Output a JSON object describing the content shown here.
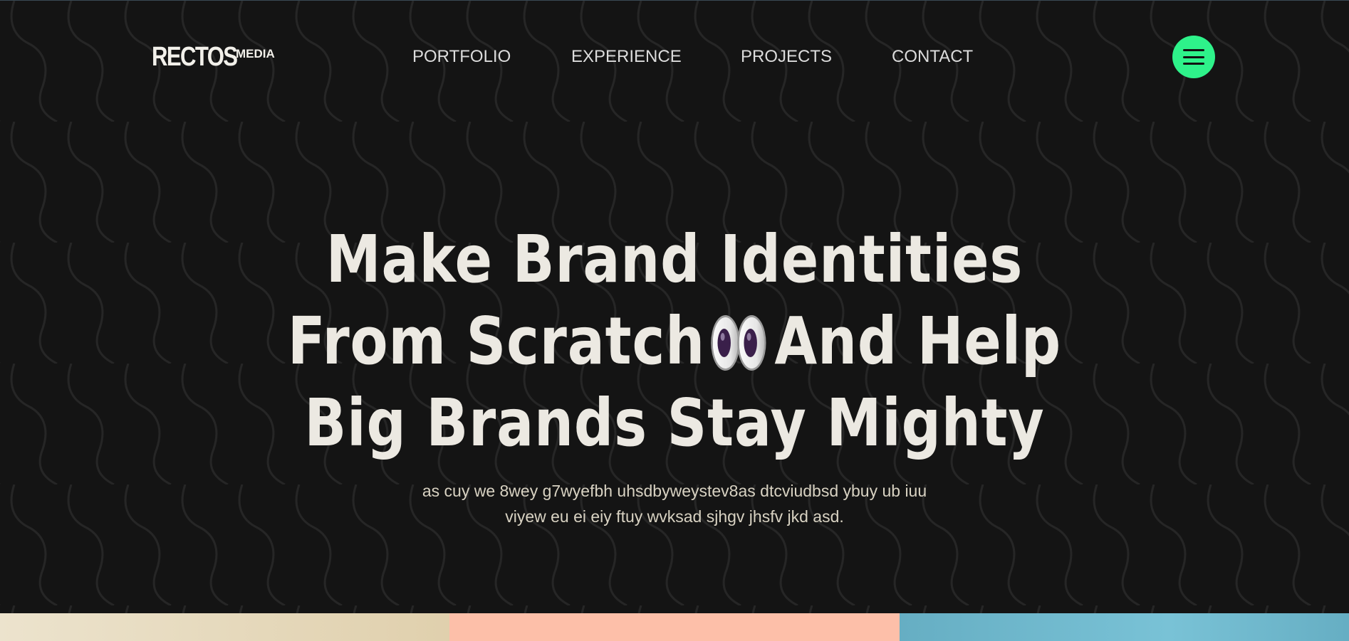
{
  "header": {
    "logo": {
      "main": "RECTOS",
      "sub": "MEDIA"
    },
    "nav": [
      {
        "label": "PORTFOLIO"
      },
      {
        "label": "EXPERIENCE"
      },
      {
        "label": "PROJECTS"
      },
      {
        "label": "CONTACT"
      }
    ],
    "menu_icon": "hamburger-menu-icon"
  },
  "hero": {
    "line1": "Make Brand Identities",
    "line2_start": "From Scratch",
    "line2_emoji": "eyes-emoji",
    "line2_end": "And Help",
    "line3": "Big Brands Stay Mighty",
    "subtitle_line1": "as cuy we 8wey g7wyefbh uhsdbyweystev8as dtcviudbsd ybuy ub iuu",
    "subtitle_line2": "viyew eu ei eiy ftuy wvksad sjhgv jhsfv jkd asd."
  },
  "colors": {
    "background": "#141414",
    "accent": "#2ef28a",
    "text": "#ece9e2",
    "strips": [
      "#e6dcc3",
      "#fdbfa9",
      "#6eb6c9"
    ]
  }
}
